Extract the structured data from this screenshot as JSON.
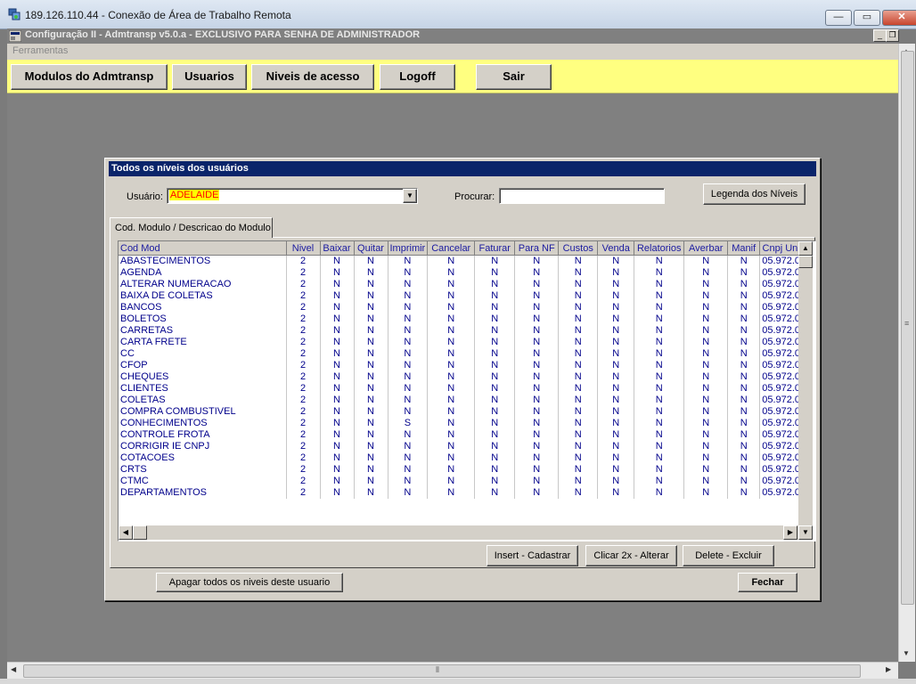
{
  "rdp": {
    "title": "189.126.110.44 - Conexão de Área de Trabalho Remota",
    "min": "—",
    "max": "▭",
    "close": "✕"
  },
  "app": {
    "title": "Configuração II - Admtransp v5.0.a - EXCLUSIVO PARA SENHA DE ADMINISTRADOR"
  },
  "menu": {
    "item": "Ferramentas"
  },
  "toolbar": {
    "modulos": "Modulos do Admtransp",
    "usuarios": "Usuarios",
    "niveis": "Niveis de acesso",
    "logoff": "Logoff",
    "sair": "Sair"
  },
  "dialog": {
    "title": "Todos os níveis dos usuários",
    "usuario_label": "Usuário:",
    "usuario_value": "ADELAIDE",
    "procurar_label": "Procurar:",
    "procurar_value": "",
    "legenda_button": "Legenda dos Níveis",
    "tab_label": "Cod. Modulo / Descricao do Modulo",
    "insert_button": "Insert - Cadastrar",
    "alterar_button": "Clicar 2x - Alterar",
    "excluir_button": "Delete - Excluir",
    "apagar_button": "Apagar todos os niveis deste usuario",
    "fechar_button": "Fechar"
  },
  "grid": {
    "columns": [
      "Cod Mod",
      "Nivel",
      "Baixar",
      "Quitar",
      "Imprimir",
      "Cancelar",
      "Faturar",
      "Para NF",
      "Custos",
      "Venda",
      "Relatorios",
      "Averbar",
      "Manif",
      "Cnpj Uni"
    ],
    "rows": [
      [
        "ABASTECIMENTOS",
        "2",
        "N",
        "N",
        "N",
        "N",
        "N",
        "N",
        "N",
        "N",
        "N",
        "N",
        "N",
        "05.972.0"
      ],
      [
        "AGENDA",
        "2",
        "N",
        "N",
        "N",
        "N",
        "N",
        "N",
        "N",
        "N",
        "N",
        "N",
        "N",
        "05.972.0"
      ],
      [
        "ALTERAR NUMERACAO",
        "2",
        "N",
        "N",
        "N",
        "N",
        "N",
        "N",
        "N",
        "N",
        "N",
        "N",
        "N",
        "05.972.0"
      ],
      [
        "BAIXA DE COLETAS",
        "2",
        "N",
        "N",
        "N",
        "N",
        "N",
        "N",
        "N",
        "N",
        "N",
        "N",
        "N",
        "05.972.0"
      ],
      [
        "BANCOS",
        "2",
        "N",
        "N",
        "N",
        "N",
        "N",
        "N",
        "N",
        "N",
        "N",
        "N",
        "N",
        "05.972.0"
      ],
      [
        "BOLETOS",
        "2",
        "N",
        "N",
        "N",
        "N",
        "N",
        "N",
        "N",
        "N",
        "N",
        "N",
        "N",
        "05.972.0"
      ],
      [
        "CARRETAS",
        "2",
        "N",
        "N",
        "N",
        "N",
        "N",
        "N",
        "N",
        "N",
        "N",
        "N",
        "N",
        "05.972.0"
      ],
      [
        "CARTA FRETE",
        "2",
        "N",
        "N",
        "N",
        "N",
        "N",
        "N",
        "N",
        "N",
        "N",
        "N",
        "N",
        "05.972.0"
      ],
      [
        "CC",
        "2",
        "N",
        "N",
        "N",
        "N",
        "N",
        "N",
        "N",
        "N",
        "N",
        "N",
        "N",
        "05.972.0"
      ],
      [
        "CFOP",
        "2",
        "N",
        "N",
        "N",
        "N",
        "N",
        "N",
        "N",
        "N",
        "N",
        "N",
        "N",
        "05.972.0"
      ],
      [
        "CHEQUES",
        "2",
        "N",
        "N",
        "N",
        "N",
        "N",
        "N",
        "N",
        "N",
        "N",
        "N",
        "N",
        "05.972.0"
      ],
      [
        "CLIENTES",
        "2",
        "N",
        "N",
        "N",
        "N",
        "N",
        "N",
        "N",
        "N",
        "N",
        "N",
        "N",
        "05.972.0"
      ],
      [
        "COLETAS",
        "2",
        "N",
        "N",
        "N",
        "N",
        "N",
        "N",
        "N",
        "N",
        "N",
        "N",
        "N",
        "05.972.0"
      ],
      [
        "COMPRA COMBUSTIVEL",
        "2",
        "N",
        "N",
        "N",
        "N",
        "N",
        "N",
        "N",
        "N",
        "N",
        "N",
        "N",
        "05.972.0"
      ],
      [
        "CONHECIMENTOS",
        "2",
        "N",
        "N",
        "S",
        "N",
        "N",
        "N",
        "N",
        "N",
        "N",
        "N",
        "N",
        "05.972.0"
      ],
      [
        "CONTROLE FROTA",
        "2",
        "N",
        "N",
        "N",
        "N",
        "N",
        "N",
        "N",
        "N",
        "N",
        "N",
        "N",
        "05.972.0"
      ],
      [
        "CORRIGIR IE CNPJ",
        "2",
        "N",
        "N",
        "N",
        "N",
        "N",
        "N",
        "N",
        "N",
        "N",
        "N",
        "N",
        "05.972.0"
      ],
      [
        "COTACOES",
        "2",
        "N",
        "N",
        "N",
        "N",
        "N",
        "N",
        "N",
        "N",
        "N",
        "N",
        "N",
        "05.972.0"
      ],
      [
        "CRTS",
        "2",
        "N",
        "N",
        "N",
        "N",
        "N",
        "N",
        "N",
        "N",
        "N",
        "N",
        "N",
        "05.972.0"
      ],
      [
        "CTMC",
        "2",
        "N",
        "N",
        "N",
        "N",
        "N",
        "N",
        "N",
        "N",
        "N",
        "N",
        "N",
        "05.972.0"
      ],
      [
        "DEPARTAMENTOS",
        "2",
        "N",
        "N",
        "N",
        "N",
        "N",
        "N",
        "N",
        "N",
        "N",
        "N",
        "N",
        "05.972.0"
      ]
    ]
  },
  "colors": {
    "toolbar_bg": "#ffff80",
    "dialog_title_bg": "#0a246a",
    "usuario_highlight": "#ffff00",
    "usuario_text": "#ff0000"
  }
}
